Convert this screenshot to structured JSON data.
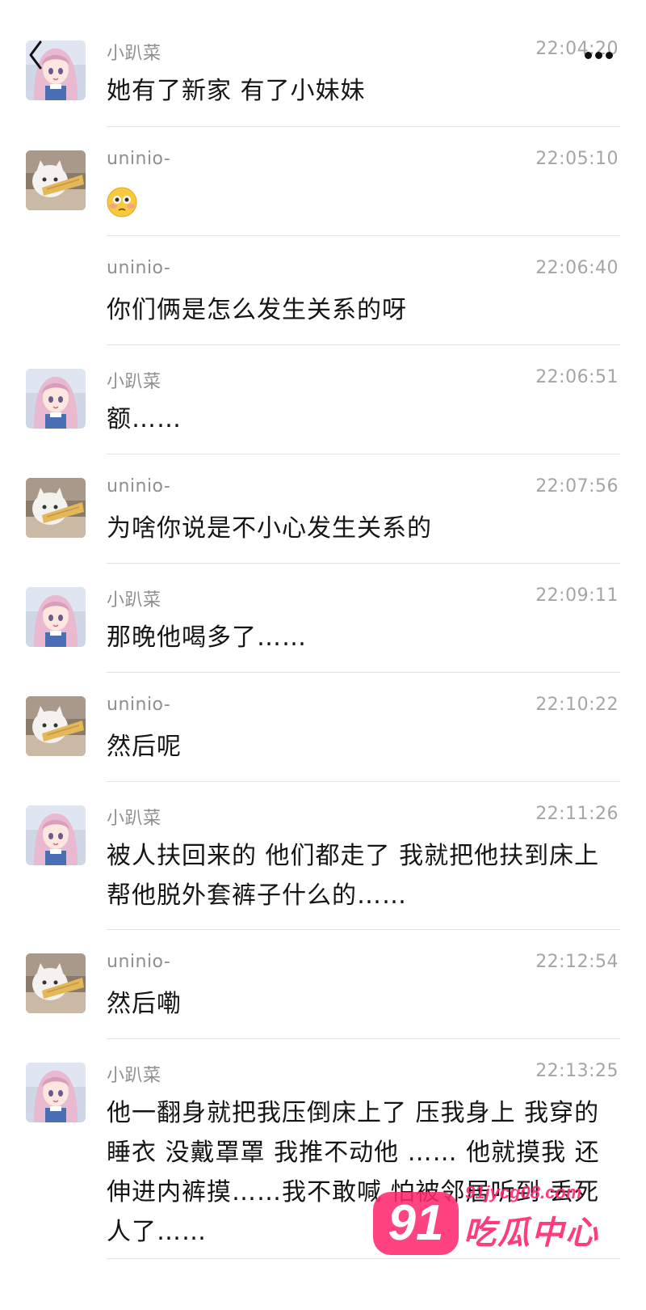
{
  "header": {
    "back_icon": "chevron-left-icon",
    "more_icon": "more-dots-icon"
  },
  "messages": [
    {
      "sender": "小趴菜",
      "time": "22:04:20",
      "text": "她有了新家  有了小妹妹",
      "avatar": "anime-girl"
    },
    {
      "sender": "uninio-",
      "time": "22:05:10",
      "text": "",
      "emoji": "flushed-face-emoji",
      "avatar": "white-cat"
    },
    {
      "sender": "uninio-",
      "time": "22:06:40",
      "text": "你们俩是怎么发生关系的呀",
      "avatar": "none"
    },
    {
      "sender": "小趴菜",
      "time": "22:06:51",
      "text": "额……",
      "avatar": "anime-girl"
    },
    {
      "sender": "uninio-",
      "time": "22:07:56",
      "text": "为啥你说是不小心发生关系的",
      "avatar": "white-cat"
    },
    {
      "sender": "小趴菜",
      "time": "22:09:11",
      "text": "那晚他喝多了……",
      "avatar": "anime-girl"
    },
    {
      "sender": "uninio-",
      "time": "22:10:22",
      "text": "然后呢",
      "avatar": "white-cat"
    },
    {
      "sender": "小趴菜",
      "time": "22:11:26",
      "text": "被人扶回来的  他们都走了  我就把他扶到床上  帮他脱外套裤子什么的……",
      "avatar": "anime-girl"
    },
    {
      "sender": "uninio-",
      "time": "22:12:54",
      "text": "然后嘞",
      "avatar": "white-cat"
    },
    {
      "sender": "小趴菜",
      "time": "22:13:25",
      "text": "他一翻身就把我压倒床上了   压我身上  我穿的睡衣   没戴罩罩  我推不动他  ……  他就摸我  还伸进内裤摸……我不敢喊  怕被邻居听到  丢死人了……",
      "avatar": "anime-girl"
    }
  ],
  "watermark": {
    "badge": "91",
    "url": "91jycg08.com",
    "name": "吃瓜中心"
  },
  "colors": {
    "sender": "#8f8f8f",
    "time": "#a5a5a5",
    "divider": "#e2e2e2",
    "watermark": "#ff286e"
  }
}
